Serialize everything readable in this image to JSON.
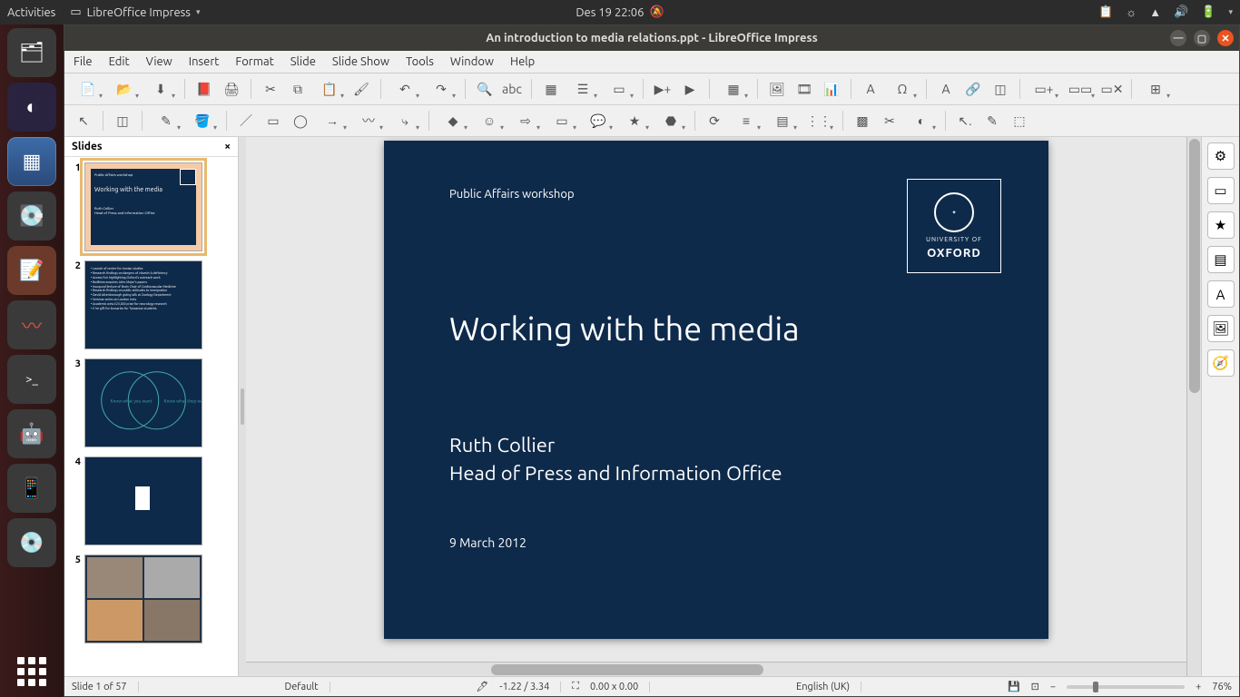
{
  "gnome": {
    "activities": "Activities",
    "app_name": "LibreOffice Impress",
    "clock": "Des 19  22:06"
  },
  "launcher": {
    "items": [
      {
        "name": "recent",
        "glyph": "🗂"
      },
      {
        "name": "eclipse",
        "glyph": "◐"
      },
      {
        "name": "screenshot",
        "glyph": "▦"
      },
      {
        "name": "disks",
        "glyph": "💿"
      },
      {
        "name": "text-editor",
        "glyph": "📝"
      },
      {
        "name": "system-monitor",
        "glyph": "〰"
      },
      {
        "name": "terminal",
        "glyph": ">_"
      },
      {
        "name": "android",
        "glyph": "🤖"
      },
      {
        "name": "phone",
        "glyph": "📱"
      },
      {
        "name": "disc",
        "glyph": "💿"
      }
    ]
  },
  "window": {
    "title": "An introduction to media relations.ppt - LibreOffice Impress"
  },
  "menubar": [
    "File",
    "Edit",
    "View",
    "Insert",
    "Format",
    "Slide",
    "Slide Show",
    "Tools",
    "Window",
    "Help"
  ],
  "toolbar1": [
    {
      "name": "new",
      "glyph": "📄",
      "dd": true
    },
    {
      "name": "open",
      "glyph": "📂",
      "dd": true
    },
    {
      "name": "save",
      "glyph": "⬇",
      "dd": true
    },
    {
      "sep": true
    },
    {
      "name": "export-pdf",
      "glyph": "📕"
    },
    {
      "name": "print",
      "glyph": "🖨"
    },
    {
      "sep": true
    },
    {
      "name": "cut",
      "glyph": "✂"
    },
    {
      "name": "copy",
      "glyph": "⧉"
    },
    {
      "name": "paste",
      "glyph": "📋",
      "dd": true
    },
    {
      "name": "clone-format",
      "glyph": "🖌"
    },
    {
      "sep": true
    },
    {
      "name": "undo",
      "glyph": "↶",
      "dd": true
    },
    {
      "name": "redo",
      "glyph": "↷",
      "dd": true
    },
    {
      "sep": true
    },
    {
      "name": "find",
      "glyph": "🔍"
    },
    {
      "name": "spellcheck",
      "glyph": "abc"
    },
    {
      "sep": true
    },
    {
      "name": "grid",
      "glyph": "▦"
    },
    {
      "name": "display-views",
      "glyph": "☰",
      "dd": true
    },
    {
      "name": "master",
      "glyph": "▭",
      "dd": true
    },
    {
      "sep": true
    },
    {
      "name": "start-beginning",
      "glyph": "▶+"
    },
    {
      "name": "start-current",
      "glyph": "▶"
    },
    {
      "sep": true
    },
    {
      "name": "insert-table",
      "glyph": "▦",
      "dd": true
    },
    {
      "sep": true
    },
    {
      "name": "insert-image",
      "glyph": "🖼"
    },
    {
      "name": "insert-av",
      "glyph": "🎞"
    },
    {
      "name": "insert-chart",
      "glyph": "📊"
    },
    {
      "sep": true
    },
    {
      "name": "text-box",
      "glyph": "A"
    },
    {
      "name": "special-char",
      "glyph": "Ω",
      "dd": true
    },
    {
      "sep": true
    },
    {
      "name": "fontwork",
      "glyph": "A"
    },
    {
      "name": "hyperlink",
      "glyph": "🔗"
    },
    {
      "name": "interaction",
      "glyph": "◫"
    },
    {
      "sep": true
    },
    {
      "name": "new-slide",
      "glyph": "▭+",
      "dd": true
    },
    {
      "name": "duplicate-slide",
      "glyph": "▭▭",
      "dd": true
    },
    {
      "name": "delete-slide",
      "glyph": "▭✕"
    },
    {
      "sep": true
    },
    {
      "name": "slide-layout",
      "glyph": "⊞",
      "dd": true
    }
  ],
  "toolbar2": [
    {
      "name": "select",
      "glyph": "↖"
    },
    {
      "sep": true
    },
    {
      "name": "zoom-pan",
      "glyph": "◫"
    },
    {
      "sep": true
    },
    {
      "name": "line-color",
      "glyph": "✎",
      "dd": true
    },
    {
      "name": "fill-color",
      "glyph": "🪣",
      "dd": true
    },
    {
      "sep": true
    },
    {
      "name": "line",
      "glyph": "／"
    },
    {
      "name": "rectangle",
      "glyph": "▭"
    },
    {
      "name": "ellipse",
      "glyph": "◯"
    },
    {
      "name": "lines-arrows",
      "glyph": "→",
      "dd": true
    },
    {
      "name": "curves",
      "glyph": "〰",
      "dd": true
    },
    {
      "name": "connectors",
      "glyph": "⤷",
      "dd": true
    },
    {
      "sep": true
    },
    {
      "name": "basic-shapes",
      "glyph": "◆",
      "dd": true
    },
    {
      "name": "symbol-shapes",
      "glyph": "☺",
      "dd": true
    },
    {
      "name": "block-arrows",
      "glyph": "⇨",
      "dd": true
    },
    {
      "name": "flowchart",
      "glyph": "▭",
      "dd": true
    },
    {
      "name": "callouts",
      "glyph": "💬",
      "dd": true
    },
    {
      "name": "stars",
      "glyph": "★",
      "dd": true
    },
    {
      "name": "3d-objects",
      "glyph": "⬣",
      "dd": true
    },
    {
      "sep": true
    },
    {
      "name": "rotate",
      "glyph": "⟳"
    },
    {
      "name": "align",
      "glyph": "≡",
      "dd": true
    },
    {
      "name": "arrange",
      "glyph": "▤",
      "dd": true
    },
    {
      "name": "distribute",
      "glyph": "⋮⋮",
      "dd": true
    },
    {
      "sep": true
    },
    {
      "name": "shadow",
      "glyph": "▩"
    },
    {
      "name": "crop",
      "glyph": "✂"
    },
    {
      "name": "filter",
      "glyph": "◐",
      "dd": true
    },
    {
      "sep": true
    },
    {
      "name": "points",
      "glyph": "↖."
    },
    {
      "name": "gluepoints",
      "glyph": "✎"
    },
    {
      "name": "extrusion",
      "glyph": "⬚"
    }
  ],
  "slides_panel": {
    "title": "Slides",
    "count": 5
  },
  "slide_content": {
    "subtitle": "Public Affairs workshop",
    "title": "Working with the media",
    "author": "Ruth Collier",
    "role": "Head of Press and Information Office",
    "date": "9 March 2012",
    "logo_top": "UNIVERSITY OF",
    "logo_bottom": "OXFORD"
  },
  "sidebar": [
    {
      "name": "properties",
      "glyph": "⚙"
    },
    {
      "name": "slide-transition",
      "glyph": "▭"
    },
    {
      "name": "animation",
      "glyph": "★"
    },
    {
      "name": "master-slides",
      "glyph": "▤"
    },
    {
      "name": "styles",
      "glyph": "A"
    },
    {
      "name": "gallery",
      "glyph": "🖼"
    },
    {
      "name": "navigator",
      "glyph": "🧭"
    }
  ],
  "statusbar": {
    "slide_info": "Slide 1 of 57",
    "master": "Default",
    "coord": "-1.22 / 3.34",
    "size": "0.00 x 0.00",
    "lang": "English (UK)",
    "zoom": "76%"
  }
}
